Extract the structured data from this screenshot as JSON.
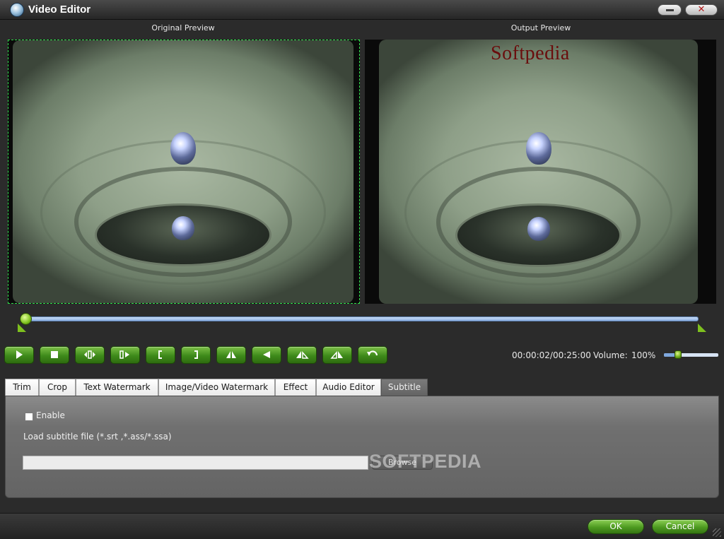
{
  "window": {
    "title": "Video Editor",
    "minimize_icon": "minimize-icon",
    "close_icon": "close-icon",
    "close_glyph": "✕"
  },
  "preview": {
    "original_label": "Original Preview",
    "output_label": "Output Preview",
    "watermark_text": "Softpedia"
  },
  "playback": {
    "seek_position": 0.0,
    "time": "00:00:02/00:25:00",
    "volume_label": "Volume:",
    "volume_value": "100%",
    "volume_level": 0.2,
    "controls": [
      {
        "name": "play-button",
        "icon": "play-icon"
      },
      {
        "name": "stop-button",
        "icon": "stop-icon"
      },
      {
        "name": "prev-frame-button",
        "icon": "prev-frame-icon"
      },
      {
        "name": "next-frame-button",
        "icon": "next-frame-icon"
      },
      {
        "name": "mark-in-button",
        "icon": "mark-in-icon"
      },
      {
        "name": "mark-out-button",
        "icon": "mark-out-icon"
      },
      {
        "name": "flip-horizontal-button",
        "icon": "flip-horizontal-icon"
      },
      {
        "name": "flip-vertical-button",
        "icon": "flip-vertical-icon"
      },
      {
        "name": "rotate-left-button",
        "icon": "rotate-left-icon"
      },
      {
        "name": "rotate-right-button",
        "icon": "rotate-right-icon"
      },
      {
        "name": "reset-button",
        "icon": "undo-icon"
      }
    ]
  },
  "tabs": [
    {
      "label": "Trim"
    },
    {
      "label": "Crop"
    },
    {
      "label": "Text Watermark"
    },
    {
      "label": "Image/Video Watermark"
    },
    {
      "label": "Effect"
    },
    {
      "label": "Audio Editor"
    },
    {
      "label": "Subtitle",
      "active": true
    }
  ],
  "subtitle": {
    "enable_label": "Enable",
    "enable_checked": false,
    "load_label": "Load subtitle file (*.srt ,*.ass/*.ssa)",
    "file_value": "",
    "browse_label": "Browse",
    "overlay_watermark": "SOFTPEDIA"
  },
  "footer": {
    "ok_label": "OK",
    "cancel_label": "Cancel"
  },
  "colors": {
    "accent_green": "#4d9a20",
    "seek_blue": "#8db0e2",
    "crop_guide": "#2ee04a",
    "watermark_red": "#6a0d0d"
  }
}
